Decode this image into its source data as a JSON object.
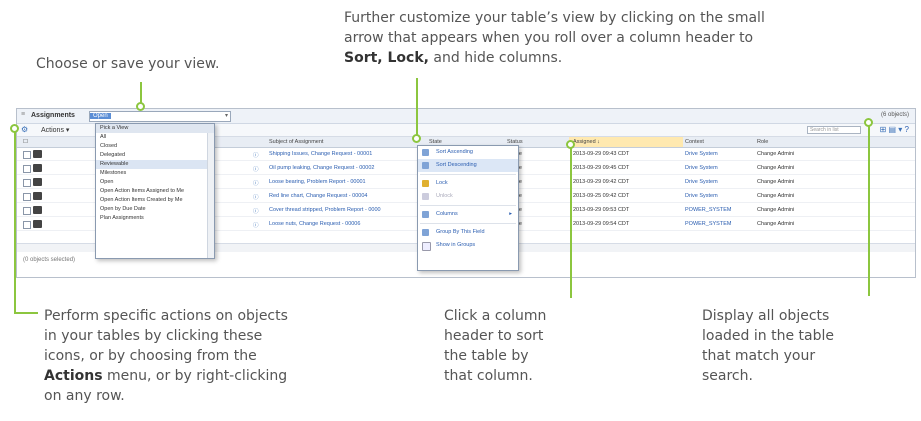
{
  "callouts": {
    "top_left": "Choose or save your view.",
    "top_right_line1": "Further customize your table’s view by clicking on the small",
    "top_right_line2": "arrow that appears when you roll over a column header to",
    "top_right_bold_sort": "Sort, Lock,",
    "top_right_tail": " and hide columns.",
    "bottom_left_line1": "Perform specific actions on objects",
    "bottom_left_line2": "in your tables by clicking these",
    "bottom_left_line3": "icons, or by choosing from the",
    "bottom_left_bold": "Actions",
    "bottom_left_line4_tail": " menu, or by right-clicking",
    "bottom_left_line5": "on any row.",
    "bottom_mid_line1": "Click a column",
    "bottom_mid_line2": "header to sort",
    "bottom_mid_line3": "the table by",
    "bottom_mid_line4": "that column.",
    "bottom_right_line1": "Display all objects",
    "bottom_right_line2": "loaded in the table",
    "bottom_right_line3": "that match your",
    "bottom_right_line4": "search."
  },
  "table": {
    "title": "Assignments",
    "view_selected": "Open",
    "object_count": "(6 objects)",
    "actions_label": "Actions",
    "search_placeholder": "Search in list",
    "footer": "(0 objects selected)",
    "headers": [
      "Subject of Assignment",
      "State",
      "Status",
      "Assigned ↓",
      "Context",
      "Role"
    ],
    "rows": [
      {
        "subject": "Shipping Issues, Change Request - 00001",
        "status": "Active",
        "assigned": "2013-09-29 09:43 CDT",
        "context": "Drive System",
        "role": "Change Admini"
      },
      {
        "subject": "Oil pump leaking, Change Request - 00002",
        "status": "Active",
        "assigned": "2013-09-29 09:45 CDT",
        "context": "Drive System",
        "role": "Change Admini"
      },
      {
        "subject": "Loose bearing, Problem Report - 00001",
        "status": "Active",
        "assigned": "2013-09-29 09:42 CDT",
        "context": "Drive System",
        "role": "Change Admini"
      },
      {
        "subject": "Red line chart, Change Request - 00004",
        "status": "Active",
        "assigned": "2013-09-25 09:42 CDT",
        "context": "Drive System",
        "role": "Change Admini"
      },
      {
        "subject": "Cover thread stripped, Problem Report - 0000",
        "status": "Active",
        "assigned": "2013-09-29 09:53 CDT",
        "context": "POWER_SYSTEM",
        "role": "Change Admini"
      },
      {
        "subject": "Loose nuts, Change Request - 00006",
        "status": "Active",
        "assigned": "2013-09-29 09:54 CDT",
        "context": "POWER_SYSTEM",
        "role": "Change Admini"
      }
    ]
  },
  "view_dropdown": {
    "header": "Pick a View",
    "options": [
      "All",
      "Closed",
      "Delegated",
      "Reviewable",
      "Milestones",
      "Open",
      "Open Action Items Assigned to Me",
      "Open Action Items Created by Me",
      "Open by Due Date",
      "Plan Assignments"
    ],
    "selected_index": 3
  },
  "context_menu": {
    "items": [
      "Sort Ascending",
      "Sort Descending",
      "Lock",
      "Unlock",
      "Columns",
      "Group By This Field",
      "Show in Groups"
    ]
  },
  "colors": {
    "accent": "#8cc63f",
    "link": "#2a5db0",
    "sorted_header": "#ffe9b0"
  }
}
